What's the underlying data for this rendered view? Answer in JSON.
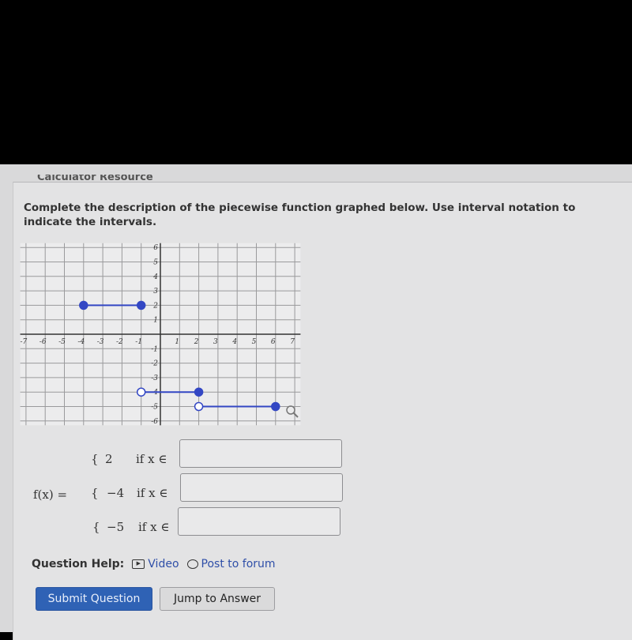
{
  "header": {
    "partial_title": "Calculator Resource"
  },
  "question": {
    "prompt": "Complete the description of the piecewise function graphed below. Use interval notation to indicate the intervals."
  },
  "chart_data": {
    "type": "line",
    "xlim": [
      -7,
      7
    ],
    "ylim": [
      -6,
      6
    ],
    "grid": true,
    "x_ticks": [
      -7,
      -6,
      -5,
      -4,
      -3,
      -2,
      -1,
      1,
      2,
      3,
      4,
      5,
      6,
      7
    ],
    "y_ticks": [
      -6,
      -5,
      -4,
      -3,
      -2,
      -1,
      1,
      2,
      3,
      4,
      5,
      6
    ],
    "segments": [
      {
        "x": [
          -4,
          -1
        ],
        "y": 2,
        "left_closed": true,
        "right_closed": true
      },
      {
        "x": [
          -1,
          2
        ],
        "y": -4,
        "left_closed": false,
        "right_closed": true
      },
      {
        "x": [
          2,
          6
        ],
        "y": -5,
        "left_closed": false,
        "right_closed": true
      }
    ],
    "color": "#3347c4",
    "icons": [
      "magnifier-icon"
    ]
  },
  "function": {
    "lhs": "f(x) =",
    "pieces": [
      {
        "brace": "{",
        "value": "2",
        "condition": "if x ∈",
        "answer": ""
      },
      {
        "brace": "{",
        "value": "−4",
        "condition": "if x ∈",
        "answer": ""
      },
      {
        "brace": "{",
        "value": "−5",
        "condition": "if x ∈",
        "answer": ""
      }
    ]
  },
  "help": {
    "label": "Question Help:",
    "video": "Video",
    "forum": "Post to forum"
  },
  "buttons": {
    "submit": "Submit Question",
    "jump": "Jump to Answer"
  },
  "colors": {
    "accent": "#2f62b5",
    "link": "#2f4fa8"
  }
}
